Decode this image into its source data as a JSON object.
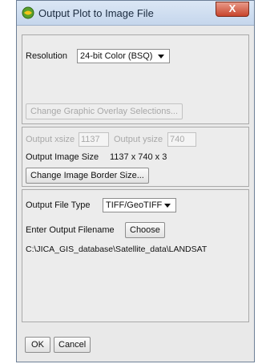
{
  "window": {
    "title": "Output Plot to Image File",
    "close_symbol": "X"
  },
  "resolution": {
    "label": "Resolution",
    "selected": "24-bit Color (BSQ)"
  },
  "graphic_overlay": {
    "button_label": "Change Graphic Overlay Selections..."
  },
  "output_size": {
    "xsize_label": "Output xsize",
    "xsize_value": "1137",
    "ysize_label": "Output ysize",
    "ysize_value": "740",
    "image_size_label": "Output Image Size",
    "image_size_value": "1137 x 740 x 3",
    "border_button_label": "Change Image Border Size..."
  },
  "output_file": {
    "type_label": "Output File Type",
    "type_selected": "TIFF/GeoTIFF",
    "filename_label": "Enter Output Filename",
    "choose_button_label": "Choose",
    "filename_value": "C:\\JICA_GIS_database\\Satellite_data\\LANDSAT"
  },
  "footer": {
    "ok_label": "OK",
    "cancel_label": "Cancel"
  },
  "colors": {
    "title_bar": "#c5d6ec",
    "close_button": "#c8452d",
    "dialog_bg": "#e9e9e9",
    "app_icon": "#5aa02c"
  }
}
